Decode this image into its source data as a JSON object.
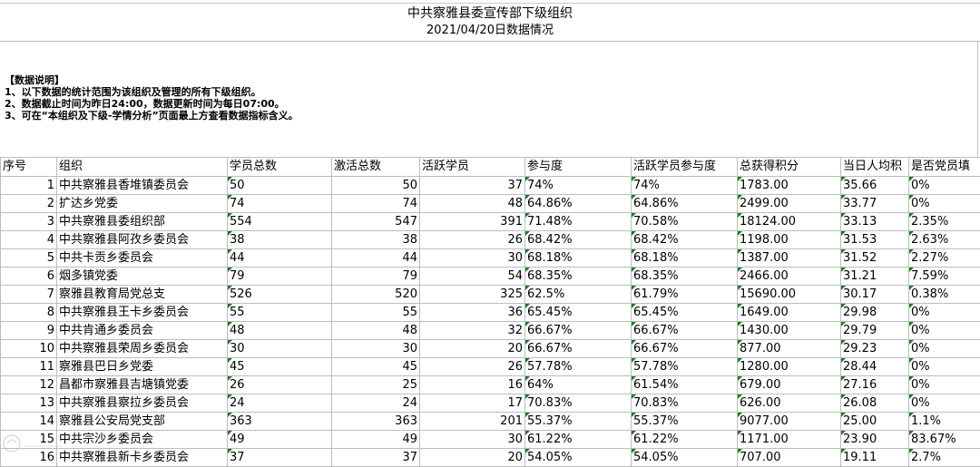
{
  "header": {
    "title": "中共察雅县委宣传部下级组织",
    "subtitle": "2021/04/20日数据情况"
  },
  "notes": {
    "heading": "【数据说明】",
    "lines": [
      "1、以下数据的统计范围为该组织及管理的所有下级组织。",
      "2、数据截止时间为昨日24:00，数据更新时间为每日07:00。",
      "3、可在“本组织及下级-学情分析”页面最上方查看数据指标含义。"
    ]
  },
  "table": {
    "columns": [
      "序号",
      "组织",
      "学员总数",
      "激活总数",
      "活跃学员",
      "参与度",
      "活跃学员参与度",
      "总获得积分",
      "当日人均积",
      "是否党员填"
    ],
    "rows": [
      [
        "1",
        "中共察雅县香堆镇委员会",
        "50",
        "50",
        "37",
        "74%",
        "74%",
        "1783.00",
        "35.66",
        "0%"
      ],
      [
        "2",
        "扩达乡党委",
        "74",
        "74",
        "48",
        "64.86%",
        "64.86%",
        "2499.00",
        "33.77",
        "0%"
      ],
      [
        "3",
        "中共察雅县委组织部",
        "554",
        "547",
        "391",
        "71.48%",
        "70.58%",
        "18124.00",
        "33.13",
        "2.35%"
      ],
      [
        "4",
        "中共察雅县阿孜乡委员会",
        "38",
        "38",
        "26",
        "68.42%",
        "68.42%",
        "1198.00",
        "31.53",
        "2.63%"
      ],
      [
        "5",
        "中共卡贡乡委员会",
        "44",
        "44",
        "30",
        "68.18%",
        "68.18%",
        "1387.00",
        "31.52",
        "2.27%"
      ],
      [
        "6",
        "烟多镇党委",
        "79",
        "79",
        "54",
        "68.35%",
        "68.35%",
        "2466.00",
        "31.21",
        "7.59%"
      ],
      [
        "7",
        "察雅县教育局党总支",
        "526",
        "520",
        "325",
        "62.5%",
        "61.79%",
        "15690.00",
        "30.17",
        "0.38%"
      ],
      [
        "8",
        "中共察雅县王卡乡委员会",
        "55",
        "55",
        "36",
        "65.45%",
        "65.45%",
        "1649.00",
        "29.98",
        "0%"
      ],
      [
        "9",
        "中共肯通乡委员会",
        "48",
        "48",
        "32",
        "66.67%",
        "66.67%",
        "1430.00",
        "29.79",
        "0%"
      ],
      [
        "10",
        "中共察雅县荣周乡委员会",
        "30",
        "30",
        "20",
        "66.67%",
        "66.67%",
        "877.00",
        "29.23",
        "0%"
      ],
      [
        "11",
        "察雅县巴日乡党委",
        "45",
        "45",
        "26",
        "57.78%",
        "57.78%",
        "1280.00",
        "28.44",
        "0%"
      ],
      [
        "12",
        "昌都市察雅县吉塘镇党委",
        "26",
        "25",
        "16",
        "64%",
        "61.54%",
        "679.00",
        "27.16",
        "0%"
      ],
      [
        "13",
        "中共察雅县察拉乡委员会",
        "24",
        "24",
        "17",
        "70.83%",
        "70.83%",
        "626.00",
        "26.08",
        "0%"
      ],
      [
        "14",
        "察雅县公安局党支部",
        "363",
        "363",
        "201",
        "55.37%",
        "55.37%",
        "9077.00",
        "25.00",
        "1.1%"
      ],
      [
        "15",
        "中共宗沙乡委员会",
        "49",
        "49",
        "30",
        "61.22%",
        "61.22%",
        "1171.00",
        "23.90",
        "83.67%"
      ],
      [
        "16",
        "中共察雅县新卡乡委员会",
        "37",
        "37",
        "20",
        "54.05%",
        "54.05%",
        "707.00",
        "19.11",
        "2.7%"
      ]
    ]
  }
}
